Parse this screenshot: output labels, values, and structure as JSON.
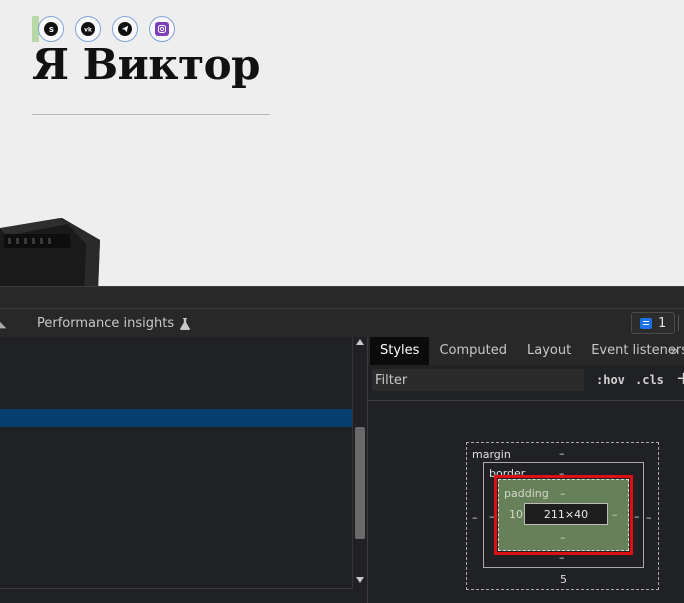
{
  "page": {
    "title": "Я Виктор",
    "socials": [
      {
        "name": "skype",
        "letter": "S"
      },
      {
        "name": "vk",
        "letter": "vk"
      },
      {
        "name": "telegram",
        "letter": "➤"
      },
      {
        "name": "instagram",
        "letter": "◎"
      }
    ]
  },
  "devtools": {
    "tab_performance": "Performance insights",
    "issues_count": "1",
    "styles_tabs": [
      "Styles",
      "Computed",
      "Layout",
      "Event listeners"
    ],
    "more_tabs": "»",
    "filter_placeholder": "Filter",
    "hov": ":hov",
    "cls": ".cls",
    "plus": "+",
    "box_model": {
      "margin_label": "margin",
      "margin_top": "–",
      "margin_bottom": "5",
      "margin_left": "–",
      "margin_right": "–",
      "border_label": "border",
      "border_top": "–",
      "border_bottom": "–",
      "border_left": "–",
      "border_right": "–",
      "padding_label": "padding",
      "padding_top": "–",
      "padding_bottom": "–",
      "padding_left": "10",
      "padding_right": "–",
      "content": "211×40"
    }
  },
  "colors": {
    "selected_row": "#073e6e",
    "padding_box": "#66805a",
    "highlight_outline": "#dd0f0f",
    "issues_icon": "#1a73e8"
  }
}
